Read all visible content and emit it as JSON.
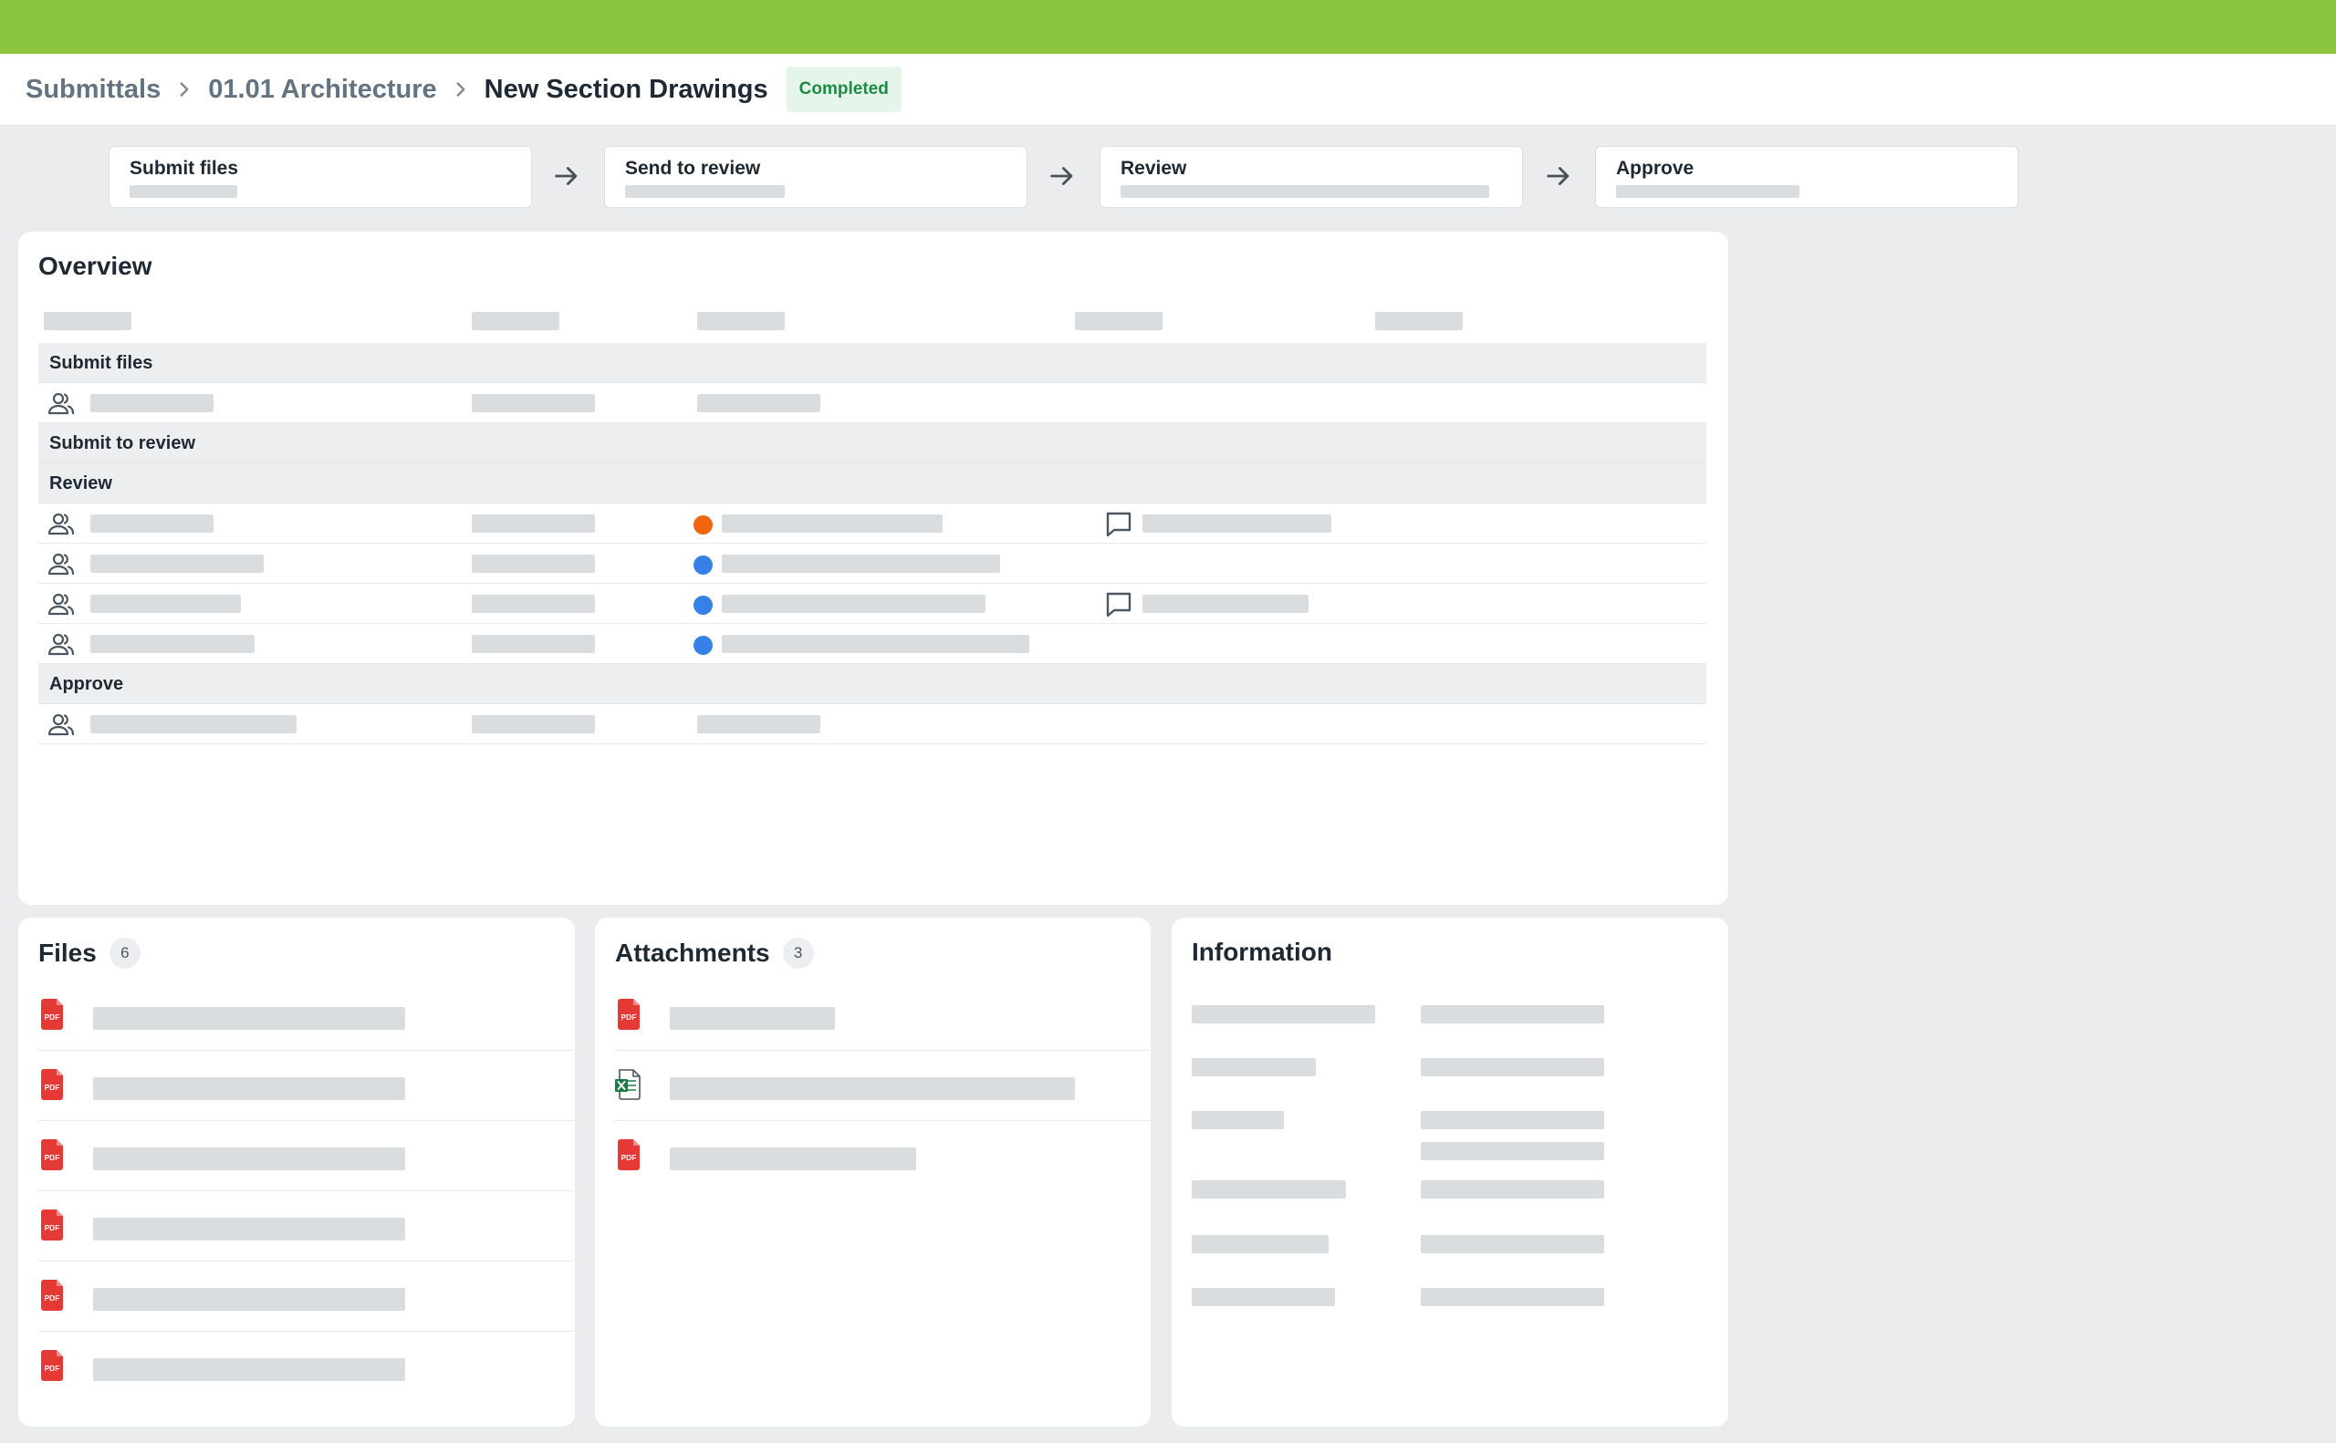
{
  "breadcrumb": {
    "items": [
      "Submittals",
      "01.01 Architecture"
    ],
    "current": "New Section Drawings",
    "status": "Completed"
  },
  "workflow": {
    "steps": [
      "Submit files",
      "Send to review",
      "Review",
      "Approve"
    ]
  },
  "overview": {
    "title": "Overview",
    "groups": [
      "Submit files",
      "Submit to review",
      "Review",
      "Approve"
    ],
    "review_status_colors": [
      "#f0650e",
      "#3581e8",
      "#3581e8",
      "#3581e8"
    ]
  },
  "files": {
    "title": "Files",
    "count": "6",
    "types": [
      "pdf",
      "pdf",
      "pdf",
      "pdf",
      "pdf",
      "pdf"
    ]
  },
  "attachments": {
    "title": "Attachments",
    "count": "3",
    "types": [
      "pdf",
      "xlsx",
      "pdf"
    ]
  },
  "information": {
    "title": "Information"
  },
  "colors": {
    "brand": "#8cc63f",
    "status_bg": "#e6f5ea",
    "status_text": "#1c8b45",
    "pdf": "#e53935",
    "excel": "#1e7a45"
  },
  "icons": [
    "chevron-right-icon",
    "arrow-right-icon",
    "user-group-icon",
    "comment-icon",
    "pdf-file-icon",
    "excel-file-icon"
  ]
}
